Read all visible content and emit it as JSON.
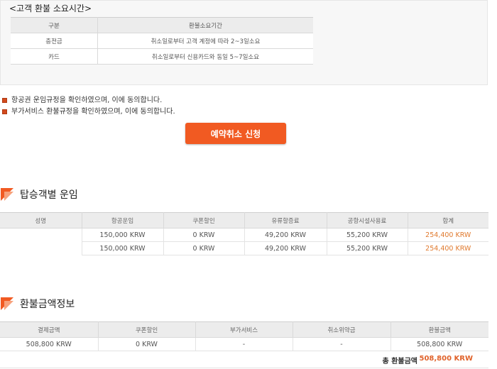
{
  "refund_time": {
    "title": "<고객 환불 소요시간>",
    "headers": [
      "구분",
      "환불소요기간"
    ],
    "rows": [
      [
        "충전금",
        "취소일로부터 고객 계정에 따라 2~3일소요"
      ],
      [
        "카드",
        "취소일로부터 신용카드와 동일 5~7일소요"
      ]
    ]
  },
  "agreements": [
    "항공권 운임규정을 확인하였으며, 이에 동의합니다.",
    "부가서비스 환불규정을 확인하였으며, 이에 동의합니다."
  ],
  "cancel_button": "예약취소 신청",
  "fare_section": {
    "title": "탑승객별 운임",
    "headers": [
      "성명",
      "항공운임",
      "쿠폰할인",
      "유류할증료",
      "공항시설사용료",
      "합계"
    ],
    "rows": [
      [
        "",
        "150,000 KRW",
        "0 KRW",
        "49,200 KRW",
        "55,200 KRW",
        "254,400 KRW"
      ],
      [
        "",
        "150,000 KRW",
        "0 KRW",
        "49,200 KRW",
        "55,200 KRW",
        "254,400 KRW"
      ]
    ]
  },
  "refund_info": {
    "title": "환불금액정보",
    "headers": [
      "결제금액",
      "쿠폰할인",
      "부가서비스",
      "취소위약금",
      "환불금액"
    ],
    "row": [
      "508,800 KRW",
      "0 KRW",
      "-",
      "-",
      "508,800 KRW"
    ],
    "total_label": "총 환불금액",
    "total_value": "508,800 KRW"
  },
  "colors": {
    "accent": "#f15a22",
    "total_text": "#e07a2e",
    "header_bg": "#ececec"
  }
}
